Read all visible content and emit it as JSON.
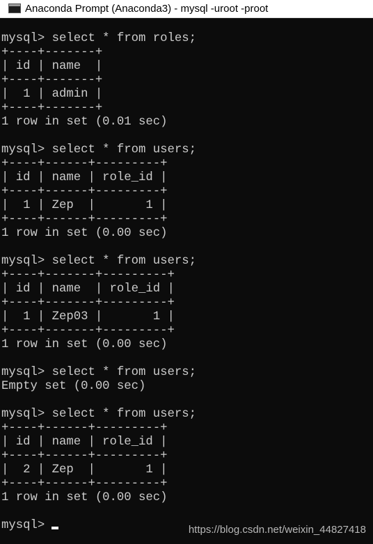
{
  "window": {
    "title": "Anaconda Prompt (Anaconda3) - mysql  -uroot -proot",
    "icon": "console-icon"
  },
  "console": {
    "lines": [
      "mysql> select * from roles;",
      "+----+-------+",
      "| id | name  |",
      "+----+-------+",
      "|  1 | admin |",
      "+----+-------+",
      "1 row in set (0.01 sec)",
      "",
      "mysql> select * from users;",
      "+----+------+---------+",
      "| id | name | role_id |",
      "+----+------+---------+",
      "|  1 | Zep  |       1 |",
      "+----+------+---------+",
      "1 row in set (0.00 sec)",
      "",
      "mysql> select * from users;",
      "+----+-------+---------+",
      "| id | name  | role_id |",
      "+----+-------+---------+",
      "|  1 | Zep03 |       1 |",
      "+----+-------+---------+",
      "1 row in set (0.00 sec)",
      "",
      "mysql> select * from users;",
      "Empty set (0.00 sec)",
      "",
      "mysql> select * from users;",
      "+----+------+---------+",
      "| id | name | role_id |",
      "+----+------+---------+",
      "|  2 | Zep  |       1 |",
      "+----+------+---------+",
      "1 row in set (0.00 sec)",
      "",
      "mysql>"
    ]
  },
  "watermark": "https://blog.csdn.net/weixin_44827418",
  "colors": {
    "background": "#0c0c0c",
    "text": "#cccccc",
    "titlebar": "#ffffff"
  }
}
